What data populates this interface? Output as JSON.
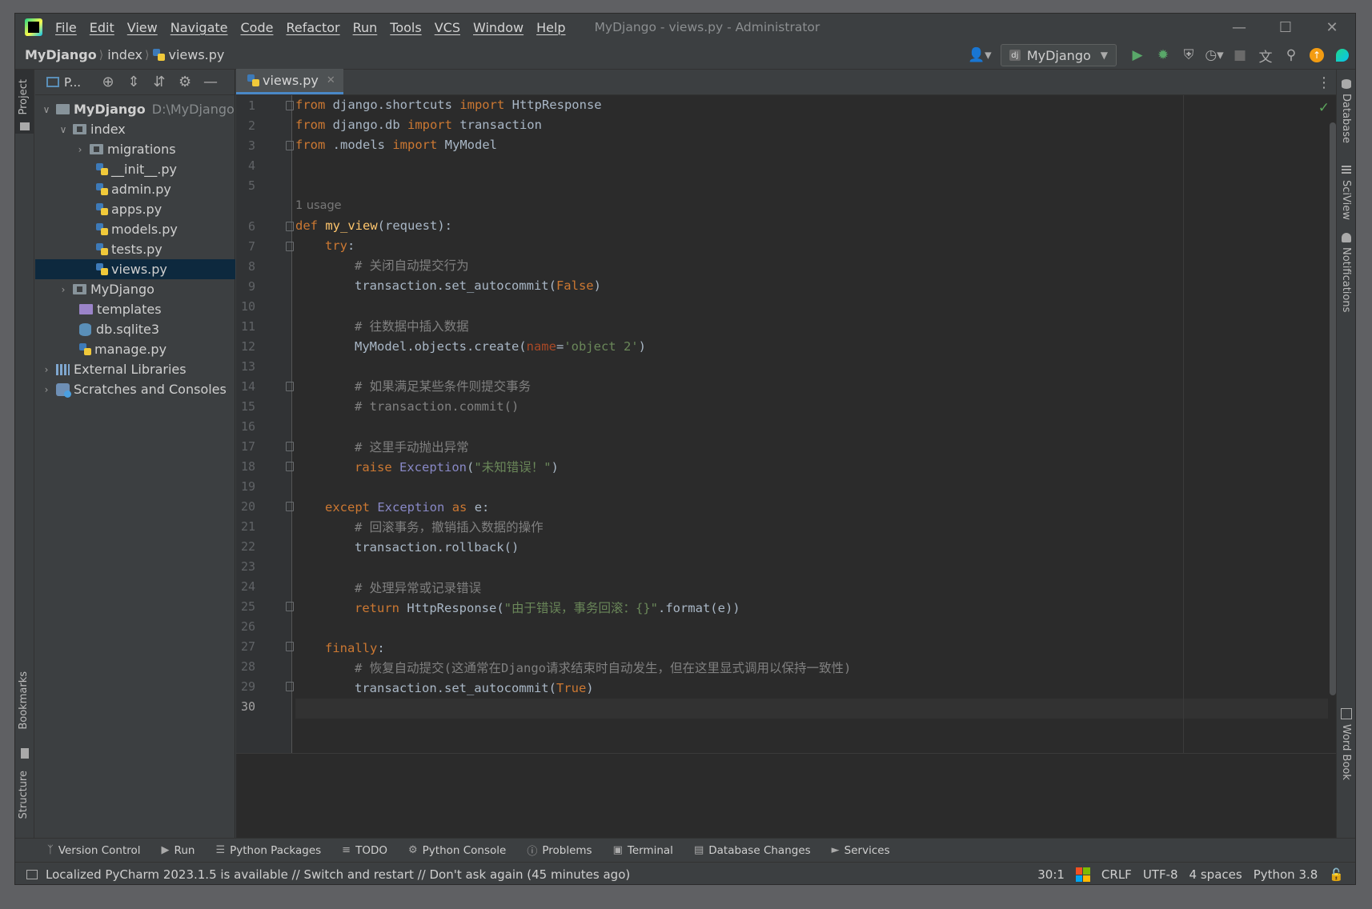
{
  "titlebar": {
    "menus": [
      "File",
      "Edit",
      "View",
      "Navigate",
      "Code",
      "Refactor",
      "Run",
      "Tools",
      "VCS",
      "Window",
      "Help"
    ],
    "window_title": "MyDjango - views.py - Administrator"
  },
  "navbar": {
    "breadcrumb": [
      "MyDjango",
      "index",
      "views.py"
    ],
    "run_config": "MyDjango"
  },
  "side_tabs": {
    "left_top": "Project",
    "left_bottom": [
      "Bookmarks",
      "Structure"
    ],
    "right": [
      "Database",
      "SciView",
      "Notifications",
      "Word Book"
    ]
  },
  "project": {
    "header": "P...",
    "root_name": "MyDjango",
    "root_path": "D:\\MyDjango",
    "items": [
      {
        "label": "index"
      },
      {
        "label": "migrations"
      },
      {
        "label": "__init__.py"
      },
      {
        "label": "admin.py"
      },
      {
        "label": "apps.py"
      },
      {
        "label": "models.py"
      },
      {
        "label": "tests.py"
      },
      {
        "label": "views.py"
      },
      {
        "label": "MyDjango"
      },
      {
        "label": "templates"
      },
      {
        "label": "db.sqlite3"
      },
      {
        "label": "manage.py"
      },
      {
        "label": "External Libraries"
      },
      {
        "label": "Scratches and Consoles"
      }
    ]
  },
  "editor": {
    "tab_label": "views.py",
    "usage_hint": "1 usage",
    "line_count": 30,
    "current_line": 30,
    "code": {
      "l1": [
        "from",
        " django.shortcuts ",
        "import",
        " HttpResponse"
      ],
      "l2": [
        "from",
        " django.db ",
        "import",
        " transaction"
      ],
      "l3": [
        "from",
        " .models ",
        "import",
        " MyModel"
      ],
      "l6": [
        "def",
        " ",
        "my_view",
        "(request):"
      ],
      "l7": [
        "try",
        ":"
      ],
      "l8": "# 关闭自动提交行为",
      "l9": [
        "transaction.set_autocommit(",
        "False",
        ")"
      ],
      "l11": "# 往数据中插入数据",
      "l12": [
        "MyModel.objects.create(",
        "name",
        "=",
        "'object 2'",
        ")"
      ],
      "l14": "# 如果满足某些条件则提交事务",
      "l15": "# transaction.commit()",
      "l17": "# 这里手动抛出异常",
      "l18": [
        "raise",
        " ",
        "Exception",
        "(",
        "\"未知错误！\"",
        ")"
      ],
      "l20": [
        "except",
        " ",
        "Exception",
        " ",
        "as",
        " e:"
      ],
      "l21": "# 回滚事务，撤销插入数据的操作",
      "l22": "transaction.rollback()",
      "l24": "# 处理异常或记录错误",
      "l25": [
        "return",
        " HttpResponse(",
        "\"由于错误，事务回滚：{}\"",
        ".format(e))"
      ],
      "l27": [
        "finally",
        ":"
      ],
      "l28": "# 恢复自动提交(这通常在Django请求结束时自动发生，但在这里显式调用以保持一致性)",
      "l29": [
        "transaction.set_autocommit(",
        "True",
        ")"
      ]
    }
  },
  "toolwindows": [
    "Version Control",
    "Run",
    "Python Packages",
    "TODO",
    "Python Console",
    "Problems",
    "Terminal",
    "Database Changes",
    "Services"
  ],
  "statusbar": {
    "message": "Localized PyCharm 2023.1.5 is available // Switch and restart // Don't ask again (45 minutes ago)",
    "position": "30:1",
    "line_sep": "CRLF",
    "encoding": "UTF-8",
    "indent": "4 spaces",
    "interpreter": "Python 3.8"
  },
  "colors": {
    "keyword": "#cc7832",
    "function": "#ffc66d",
    "string": "#6a8759",
    "comment": "#808080",
    "selection": "#0d293e"
  }
}
